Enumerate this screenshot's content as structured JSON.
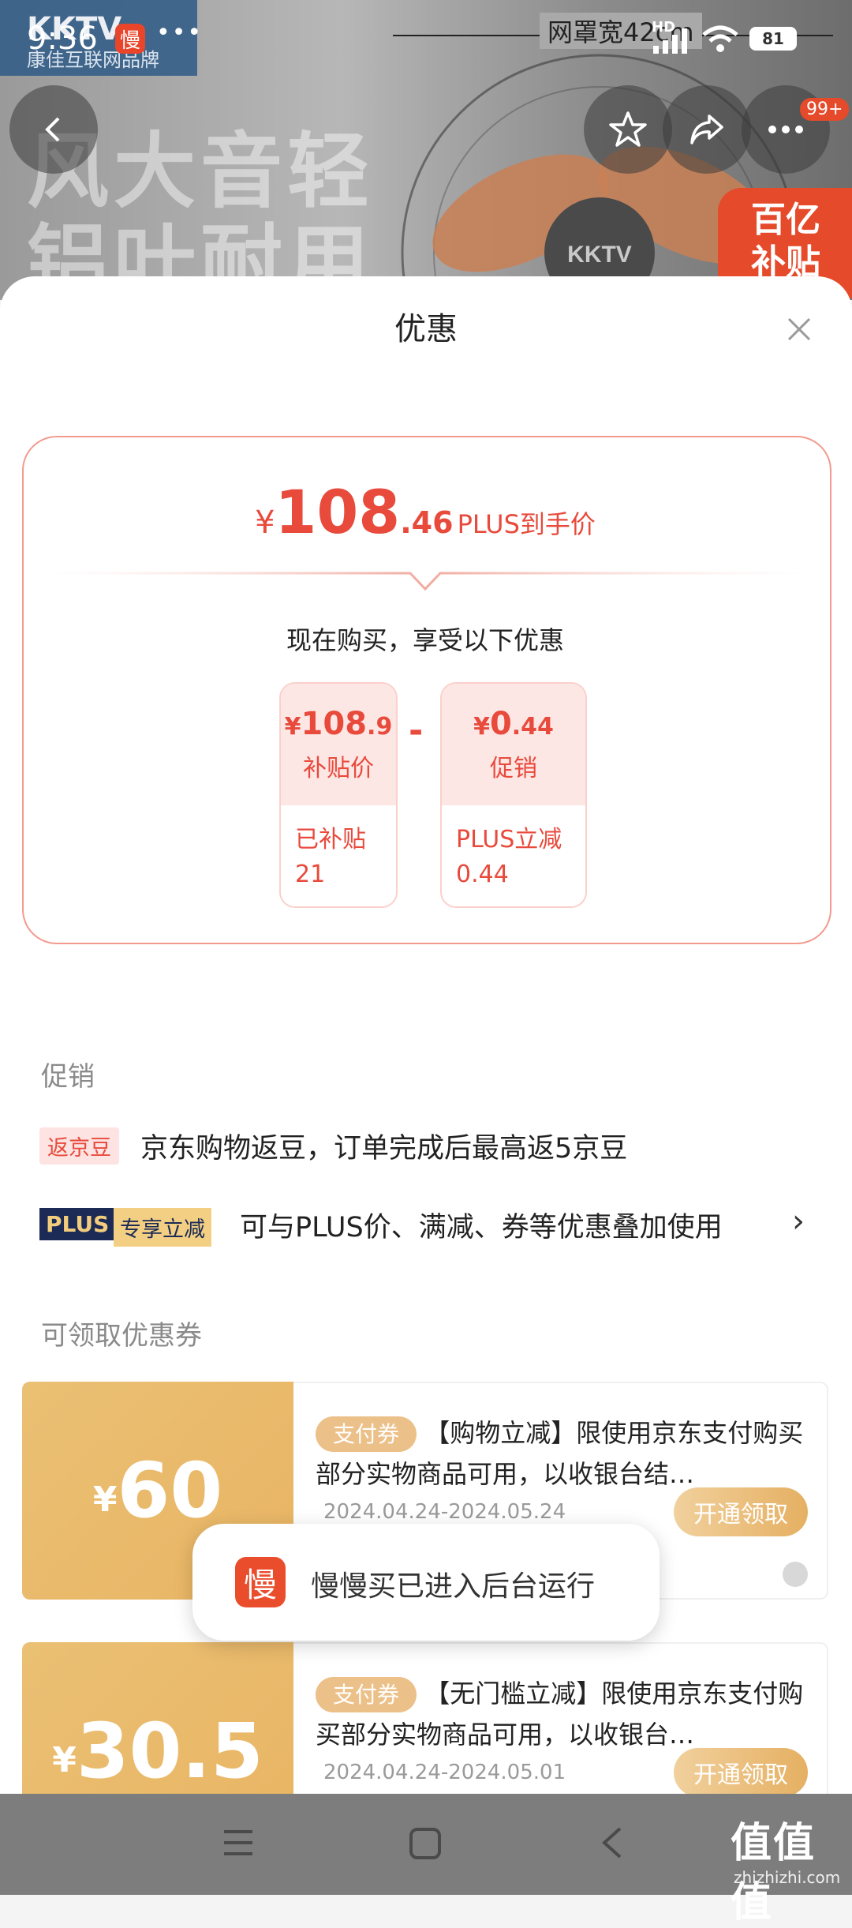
{
  "status_bar": {
    "time": "9:36",
    "app_badge": "慢",
    "dots": "•••",
    "network": "HD",
    "battery": "81"
  },
  "banner": {
    "brand": "KKTV",
    "brand_sub": "康佳互联网品牌",
    "measure": "网罩宽42cm",
    "headline_1": "风大音轻",
    "headline_2": "铝叶耐用",
    "badge_line1": "百亿",
    "badge_line2": "补贴",
    "notif_count": "99+",
    "fan_logo": "KKTV"
  },
  "sheet": {
    "title": "优惠"
  },
  "price": {
    "currency": "¥",
    "int": "108",
    "dec": ".46",
    "label": "PLUS到手价",
    "subtitle": "现在购买，享受以下优惠",
    "minus": "-",
    "box1": {
      "currency": "¥",
      "int": "108",
      "dec": ".9",
      "label": "补贴价",
      "detail": "已补贴21"
    },
    "box2": {
      "currency": "¥",
      "int": "0",
      "dec": ".44",
      "label": "促销",
      "detail": "PLUS立减0.44"
    }
  },
  "promotions": {
    "heading": "促销",
    "items": [
      {
        "tag": "返京豆",
        "text": "京东购物返豆，订单完成后最高返5京豆"
      },
      {
        "tag_a": "PLUS",
        "tag_b": "专享立减",
        "text": "可与PLUS价、满减、券等优惠叠加使用",
        "arrow": "›"
      }
    ]
  },
  "coupons": {
    "heading": "可领取优惠券",
    "items": [
      {
        "currency": "¥",
        "amount": "60",
        "tag": "支付券",
        "desc": "【购物立减】限使用京东支付购买部分实物商品可用，以收银台结…",
        "date": "2024.04.24-2024.05.24",
        "button": "开通领取"
      },
      {
        "currency": "¥",
        "amount": "30.5",
        "tag": "支付券",
        "desc": "【无门槛立减】限使用京东支付购买部分实物商品可用，以收银台…",
        "date": "2024.04.24-2024.05.01",
        "button": "开通领取"
      }
    ]
  },
  "toast": {
    "icon_char": "慢",
    "text": "慢慢买已进入后台运行"
  },
  "watermark": {
    "text": "值值值",
    "domain": "zhizhizhi.com"
  }
}
